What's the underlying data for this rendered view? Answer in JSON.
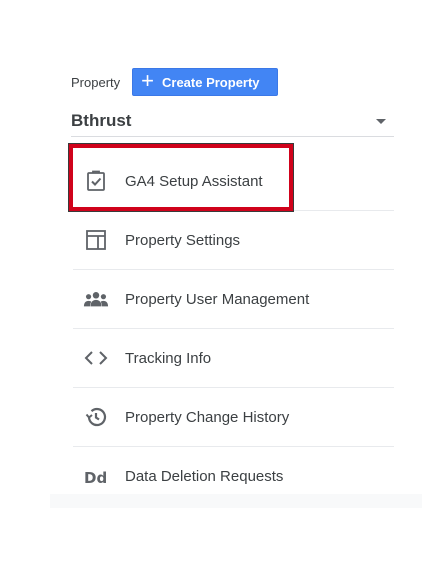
{
  "property": {
    "label": "Property",
    "create_button_label": "Create Property",
    "selected_name": "Bthrust"
  },
  "menu": {
    "items": [
      {
        "label": "GA4 Setup Assistant",
        "icon": "clipboard-check-icon"
      },
      {
        "label": "Property Settings",
        "icon": "layout-icon"
      },
      {
        "label": "Property User Management",
        "icon": "people-icon"
      },
      {
        "label": "Tracking Info",
        "icon": "code-icon"
      },
      {
        "label": "Property Change History",
        "icon": "history-icon"
      },
      {
        "label": "Data Deletion Requests",
        "icon": "dd-icon"
      }
    ]
  },
  "colors": {
    "accent": "#4285f4",
    "highlight": "#d0021b",
    "icon": "#5f6368"
  }
}
